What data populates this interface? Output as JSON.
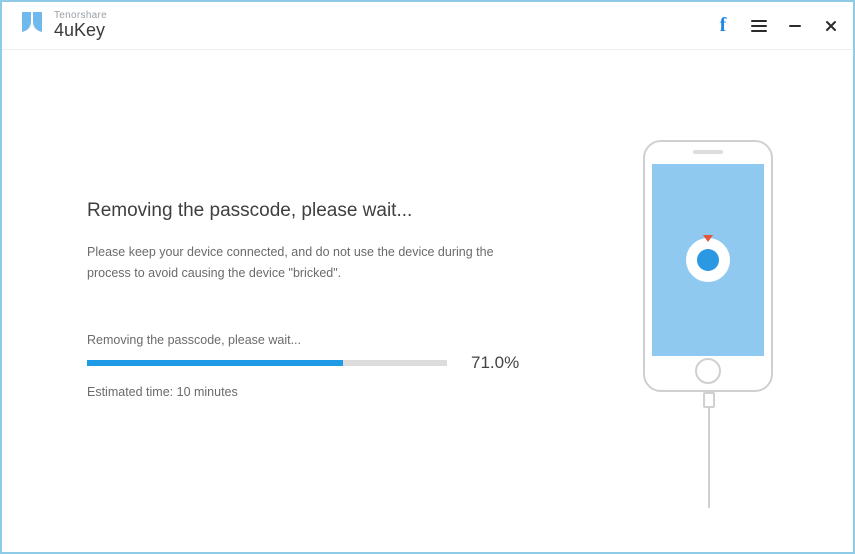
{
  "brand": {
    "company": "Tenorshare",
    "product": "4uKey"
  },
  "progress": {
    "headline": "Removing the passcode, please wait...",
    "notice": "Please keep your device connected, and do not use the device during the process to avoid causing the device \"bricked\".",
    "status_label": "Removing the passcode, please wait...",
    "percent_text": "71.0%",
    "percent_value": 71.0,
    "eta": "Estimated time: 10 minutes"
  },
  "colors": {
    "accent": "#1e9ae6",
    "window_border": "#8ecbe6",
    "phone_screen": "#8fc9ef"
  }
}
